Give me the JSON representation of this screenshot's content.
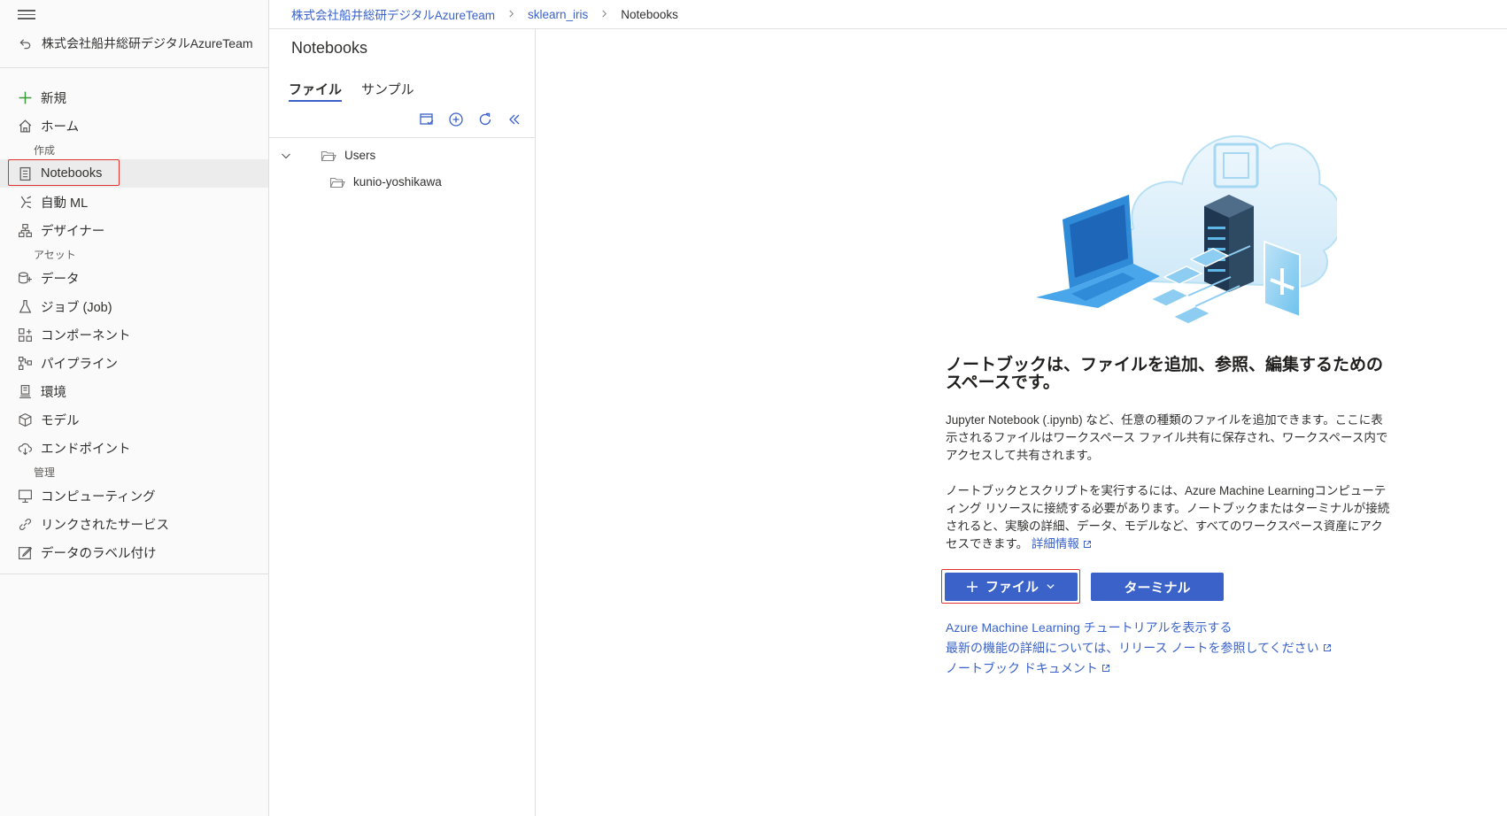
{
  "sidebar": {
    "workspace_name": "株式会社船井総研デジタルAzureTeam",
    "new_label": "新規",
    "home_label": "ホーム",
    "group_author": "作成",
    "notebooks_label": "Notebooks",
    "automl_label": "自動 ML",
    "designer_label": "デザイナー",
    "group_assets": "アセット",
    "data_label": "データ",
    "jobs_label": "ジョブ (Job)",
    "components_label": "コンポーネント",
    "pipelines_label": "パイプライン",
    "environments_label": "環境",
    "models_label": "モデル",
    "endpoints_label": "エンドポイント",
    "group_manage": "管理",
    "compute_label": "コンピューティング",
    "linked_services_label": "リンクされたサービス",
    "data_labeling_label": "データのラベル付け"
  },
  "breadcrumb": {
    "workspace": "株式会社船井総研デジタルAzureTeam",
    "experiment": "sklearn_iris",
    "current": "Notebooks"
  },
  "files": {
    "title": "Notebooks",
    "tab_files": "ファイル",
    "tab_samples": "サンプル",
    "tree_root": "Users",
    "tree_child": "kunio-yoshikawa"
  },
  "main": {
    "headline": "ノートブックは、ファイルを追加、参照、編集するためのスペースです。",
    "para1": "Jupyter Notebook (.ipynb) など、任意の種類のファイルを追加できます。ここに表示されるファイルはワークスペース ファイル共有に保存され、ワークスペース内でアクセスして共有されます。",
    "para2": "ノートブックとスクリプトを実行するには、Azure Machine Learningコンピューティング リソースに接続する必要があります。ノートブックまたはターミナルが接続されると、実験の詳細、データ、モデルなど、すべてのワークスペース資産にアクセスできます。",
    "learn_more": "詳細情報",
    "file_button": "ファイル",
    "terminal_button": "ターミナル",
    "link_tutorial": "Azure Machine Learning チュートリアルを表示する",
    "link_release_notes": "最新の機能の詳細については、リリース ノートを参照してください",
    "link_docs": "ノートブック ドキュメント"
  },
  "colors": {
    "accent": "#3a62c9",
    "highlight": "#e03131"
  }
}
